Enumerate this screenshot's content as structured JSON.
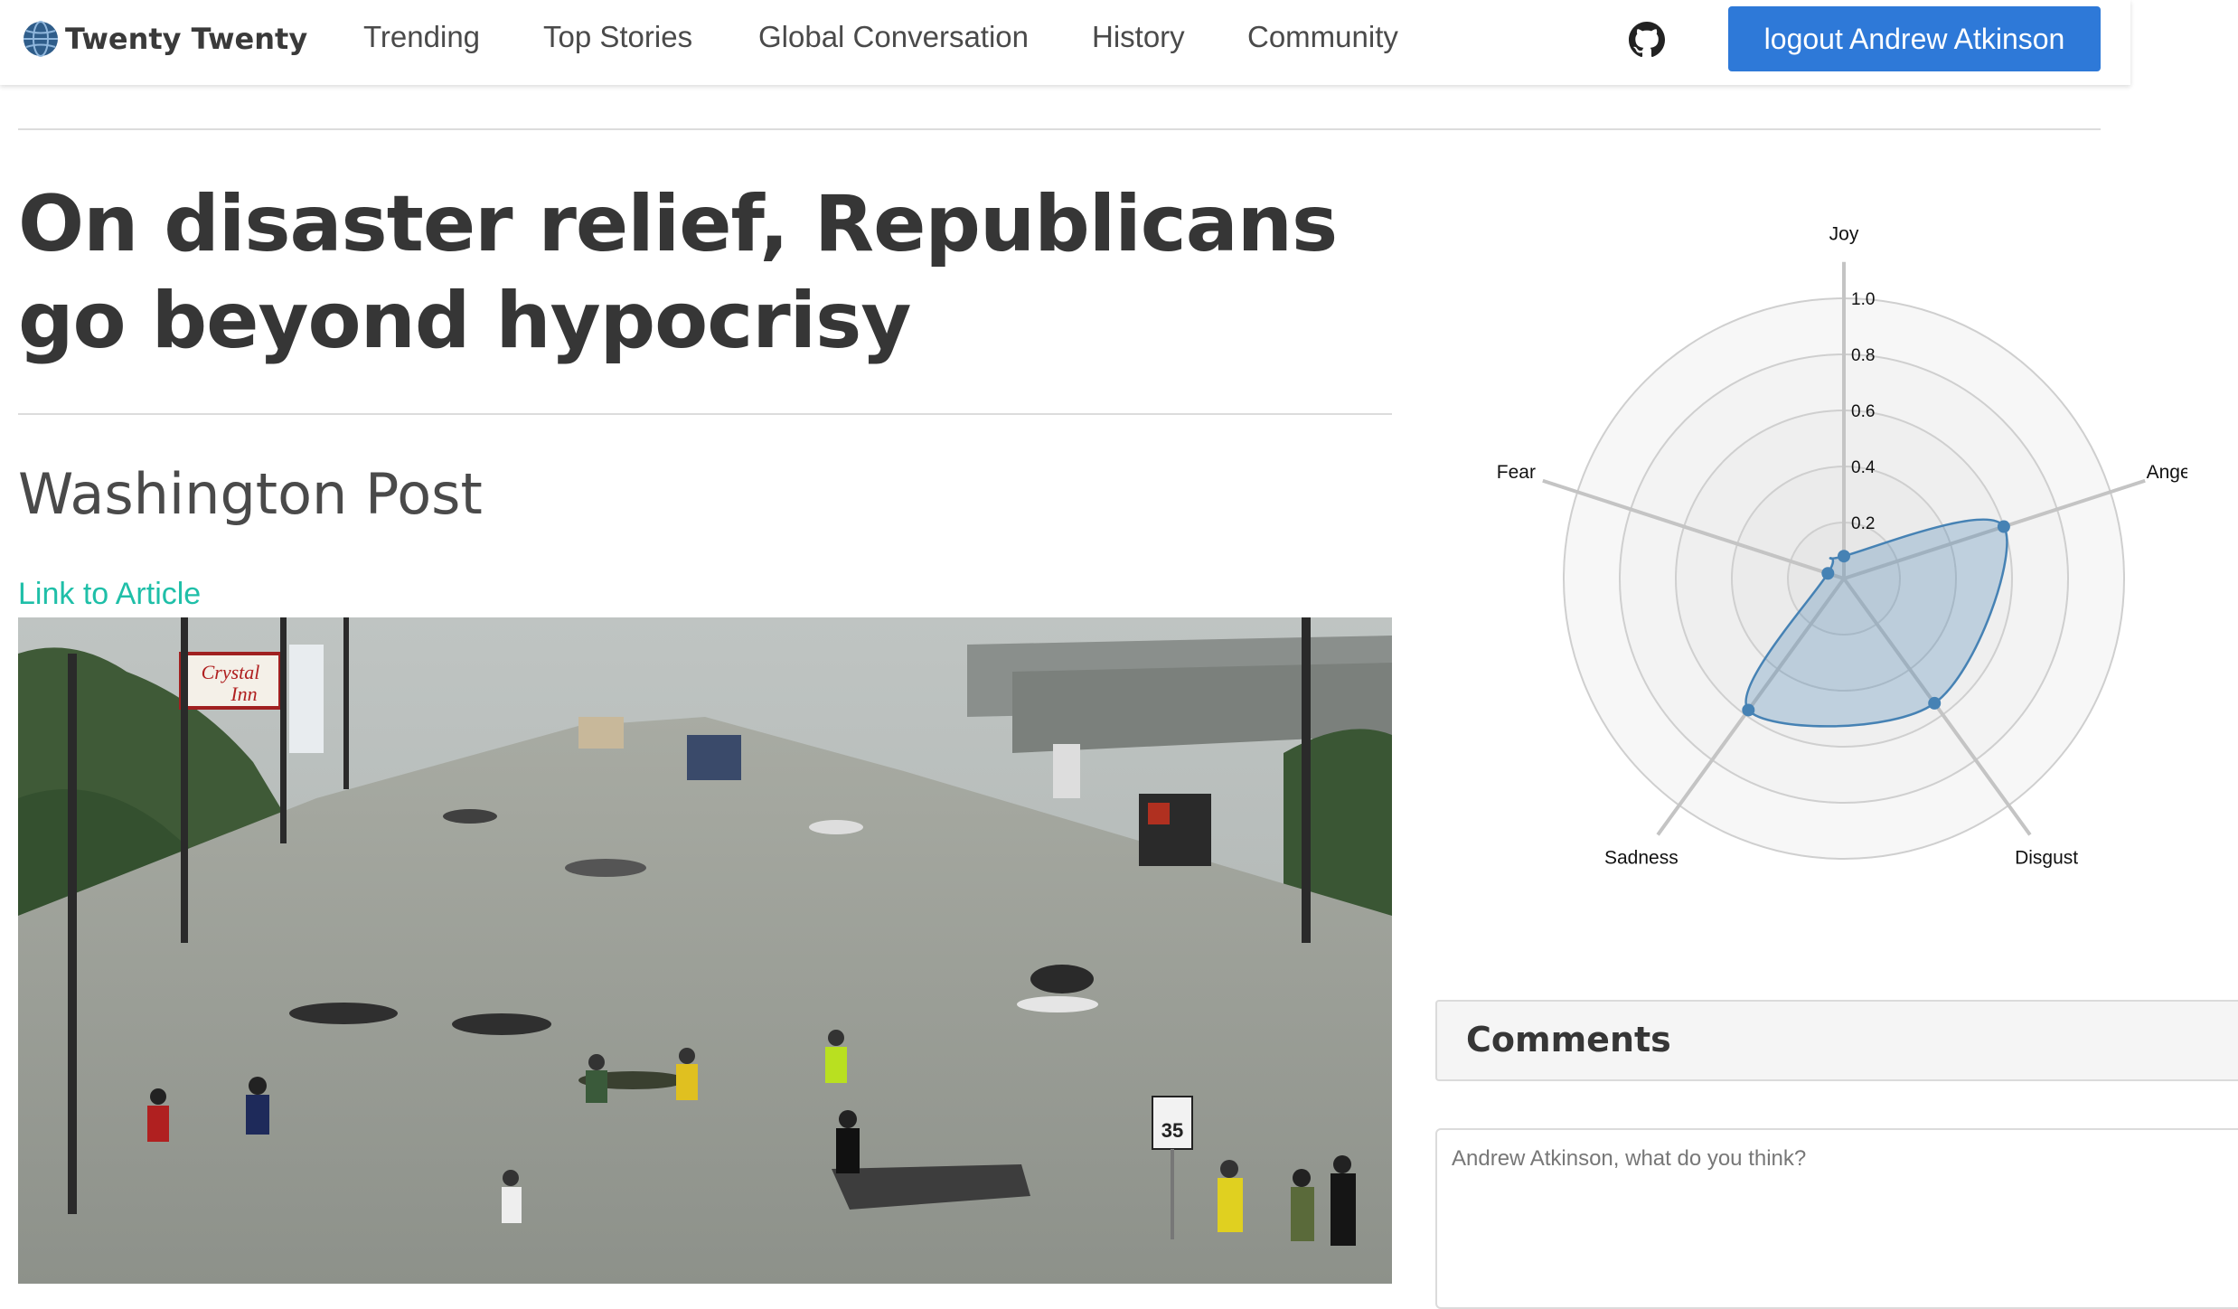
{
  "navbar": {
    "brand": "Twenty Twenty",
    "links": [
      "Trending",
      "Top Stories",
      "Global Conversation",
      "History",
      "Community"
    ],
    "logout_label": "logout Andrew Atkinson"
  },
  "article": {
    "headline": "On disaster relief, Republicans go beyond hypocrisy",
    "source": "Washington Post",
    "link_label": "Link to Article"
  },
  "sentiment": {
    "chart_data": {
      "type": "radar",
      "axes": [
        "Joy",
        "Anger",
        "Disgust",
        "Sadness",
        "Fear"
      ],
      "values": [
        0.08,
        0.6,
        0.55,
        0.58,
        0.06
      ],
      "rlim": [
        0,
        1.0
      ],
      "ticks": [
        "0.2",
        "0.4",
        "0.6",
        "0.8",
        "1.0"
      ],
      "fill_color": "#4682b4",
      "grid": true
    }
  },
  "comments": {
    "title": "Comments",
    "placeholder": "Andrew Atkinson, what do you think?"
  },
  "colors": {
    "primary_button": "#2e79d8",
    "link": "#1fbfa8",
    "series": "#4682b4"
  },
  "icons": {
    "brand": "globe-icon",
    "repo": "github-icon"
  }
}
